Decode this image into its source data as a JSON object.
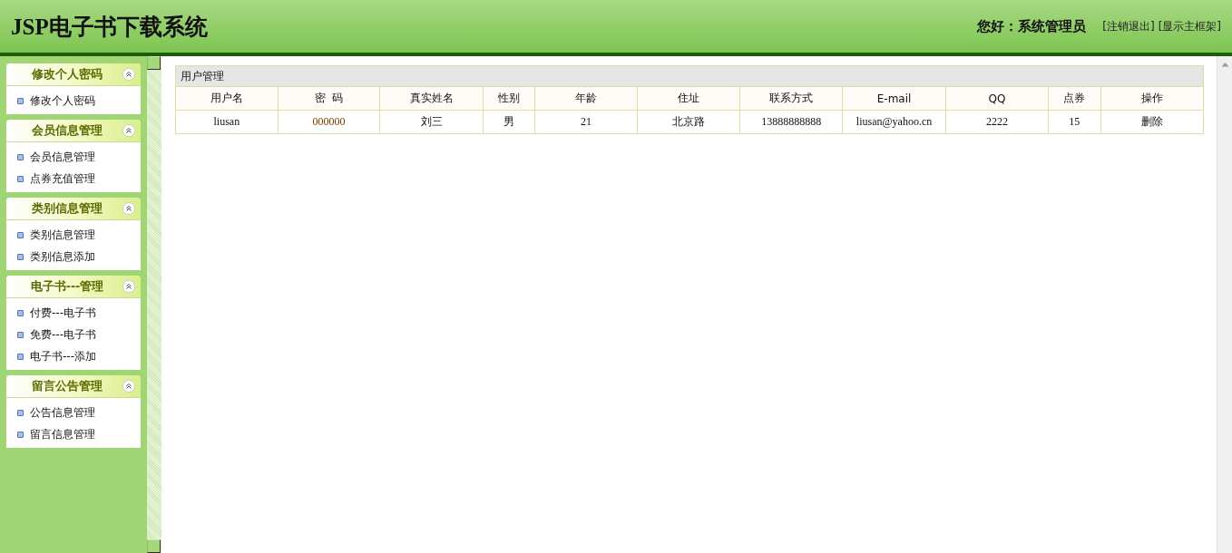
{
  "header": {
    "title": "JSP电子书下载系统",
    "greeting": "您好：系统管理员",
    "links": [
      "[注销退出]",
      "[显示主框架]"
    ]
  },
  "sidebar": {
    "panels": [
      {
        "title": "修改个人密码",
        "items": [
          "修改个人密码"
        ]
      },
      {
        "title": "会员信息管理",
        "items": [
          "会员信息管理",
          "点券充值管理"
        ]
      },
      {
        "title": "类别信息管理",
        "items": [
          "类别信息管理",
          "类别信息添加"
        ]
      },
      {
        "title": "电子书---管理",
        "items": [
          "付费---电子书",
          "免费---电子书",
          "电子书---添加"
        ]
      },
      {
        "title": "留言公告管理",
        "items": [
          "公告信息管理",
          "留言信息管理"
        ]
      }
    ]
  },
  "table": {
    "caption": "用户管理",
    "columns": [
      "用户名",
      "密  码",
      "真实姓名",
      "性别",
      "年龄",
      "住址",
      "联系方式",
      "E-mail",
      "QQ",
      "点券",
      "操作"
    ],
    "rows": [
      [
        "liusan",
        "000000",
        "刘三",
        "男",
        "21",
        "北京路",
        "13888888888",
        "liusan@yahoo.cn",
        "2222",
        "15",
        "删除"
      ]
    ]
  }
}
